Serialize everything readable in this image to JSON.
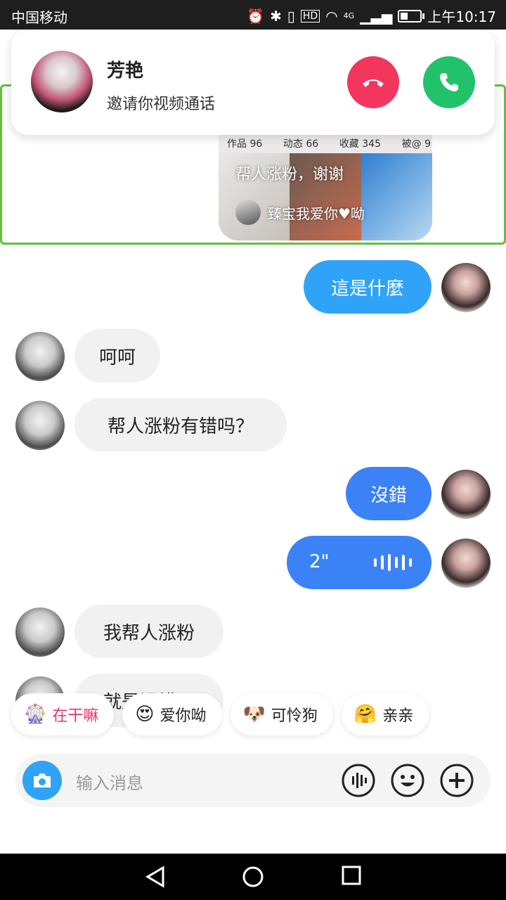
{
  "status_bar": {
    "carrier": "中国移动",
    "network": "4G",
    "time": "上午10:17",
    "hd": "HD"
  },
  "notification": {
    "caller_name": "芳艳",
    "message": "邀请你视频通话",
    "decline_icon": "phone-hangup-icon",
    "accept_icon": "phone-icon"
  },
  "card": {
    "stats": [
      "作品 96",
      "动态 66",
      "收藏 345",
      "被@ 9"
    ],
    "caption": "帮人涨粉，谢谢",
    "author": "臻宝我爱你♥呦"
  },
  "messages": [
    {
      "side": "out",
      "text": "這是什麼"
    },
    {
      "side": "in",
      "text": "呵呵"
    },
    {
      "side": "in",
      "text": "帮人涨粉有错吗？"
    },
    {
      "side": "out",
      "text": "沒錯"
    },
    {
      "side": "out",
      "type": "voice",
      "text": "2\""
    },
    {
      "side": "in",
      "text": "我帮人涨粉"
    },
    {
      "side": "in",
      "text": "就是没错呀"
    }
  ],
  "quick_replies": [
    {
      "emoji": "🎡",
      "label": "在干嘛"
    },
    {
      "emoji": "😍",
      "label": "爱你呦"
    },
    {
      "emoji": "🐶",
      "label": "可怜狗"
    },
    {
      "emoji": "🤗",
      "label": "亲亲"
    }
  ],
  "input": {
    "placeholder": "输入消息"
  },
  "colors": {
    "accent": "#2fa3f7",
    "decline": "#f2365e",
    "accept": "#22c26a",
    "frame": "#64bf3d"
  }
}
